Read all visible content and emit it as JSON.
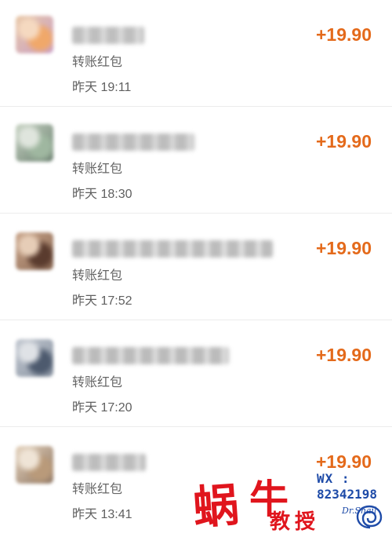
{
  "transactions": [
    {
      "type": "转账红包",
      "time": "昨天 19:11",
      "amount": "+19.90",
      "avatar_colors": [
        "#f0a86a",
        "#e8c7a5",
        "#c9a0c8",
        "#f5d9c0"
      ],
      "name_colors": [
        "#bfbfbf",
        "#d8d8d8"
      ]
    },
    {
      "type": "转账红包",
      "time": "昨天 18:30",
      "amount": "+19.90",
      "avatar_colors": [
        "#9fb7a0",
        "#c8d4c4",
        "#6b7f70",
        "#dfe5dd"
      ],
      "name_colors": [
        "#bdbdbd",
        "#d6d6d6"
      ]
    },
    {
      "type": "转账红包",
      "time": "昨天 17:52",
      "amount": "+19.90",
      "avatar_colors": [
        "#5a3b2e",
        "#c9a58a",
        "#8c6a55",
        "#e6cdb7"
      ],
      "name_colors": [
        "#bcbcbc",
        "#dcdcdc"
      ]
    },
    {
      "type": "转账红包",
      "time": "昨天 17:20",
      "amount": "+19.90",
      "avatar_colors": [
        "#4d5a6e",
        "#c0c6cf",
        "#8b95a3",
        "#dfe2e6"
      ],
      "name_colors": [
        "#bbbbbb",
        "#d9d9d9"
      ]
    },
    {
      "type": "转账红包",
      "time": "昨天 13:41",
      "amount": "+19.90",
      "avatar_colors": [
        "#b99a7a",
        "#e5d3bd",
        "#8d7562",
        "#efe4d6"
      ],
      "name_colors": [
        "#bdbdbd",
        "#d7d7d7"
      ]
    }
  ],
  "watermark": {
    "char1": "蜗",
    "char2": "牛",
    "char3": "教",
    "char4": "授",
    "wx_label": "WX :",
    "wx_number": "82342198",
    "brand": "Dr.Snail",
    "red": "#e0151d",
    "blue": "#1e4ba8"
  },
  "colors": {
    "amount": "#e46a1b",
    "subtext": "#666666"
  }
}
